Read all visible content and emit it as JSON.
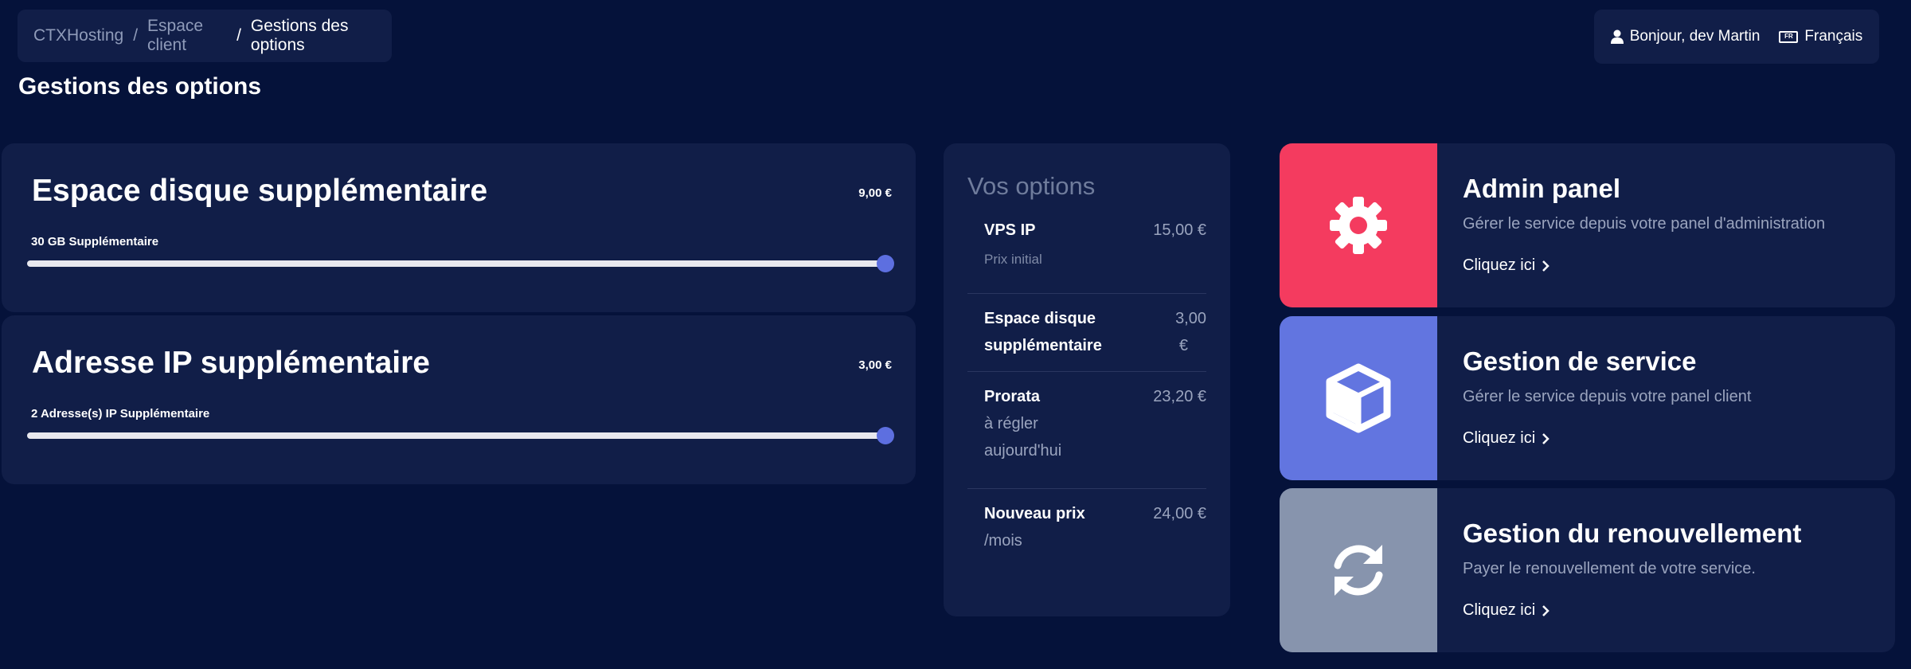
{
  "breadcrumb": {
    "items": [
      "CTXHosting",
      "Espace client",
      "Gestions des options"
    ],
    "separator": "/"
  },
  "user": {
    "greeting": "Bonjour, dev Martin",
    "language": "Français",
    "flag_text": "FR"
  },
  "page_title": "Gestions des options",
  "options": [
    {
      "title": "Espace disque supplémentaire",
      "price": "9,00 €",
      "quantity_label": "30 GB Supplémentaire",
      "slider_value": 1.0
    },
    {
      "title": "Adresse IP supplémentaire",
      "price": "3,00 €",
      "quantity_label": "2 Adresse(s) IP Supplémentaire",
      "slider_value": 1.0
    }
  ],
  "summary": {
    "title": "Vos options",
    "rows": [
      {
        "label": "VPS IP",
        "value": "15,00 €",
        "note": "Prix initial"
      },
      {
        "label_line1": "Espace disque",
        "label_line2": "supplémentaire",
        "value_line1": "3,00",
        "value_line2": "€"
      },
      {
        "label": "Prorata",
        "value": "23,20 €",
        "note_line1": "à régler",
        "note_line2": "aujourd'hui"
      },
      {
        "label": "Nouveau prix",
        "value": "24,00 €",
        "note": "/mois"
      }
    ]
  },
  "actions": [
    {
      "title": "Admin panel",
      "description": "Gérer le service depuis votre panel d'administration",
      "link": "Cliquez ici",
      "icon": "gear-icon",
      "color": "#f43b5f"
    },
    {
      "title": "Gestion de service",
      "description": "Gérer le service depuis votre panel client",
      "link": "Cliquez ici",
      "icon": "cube-icon",
      "color": "#6275e0"
    },
    {
      "title": "Gestion du renouvellement",
      "description": "Payer le renouvellement de votre service.",
      "link": "Cliquez ici",
      "icon": "sync-icon",
      "color": "#8794ad"
    }
  ],
  "colors": {
    "background": "#05123a",
    "card": "#111e48",
    "slider_thumb": "#5d6fe0"
  }
}
